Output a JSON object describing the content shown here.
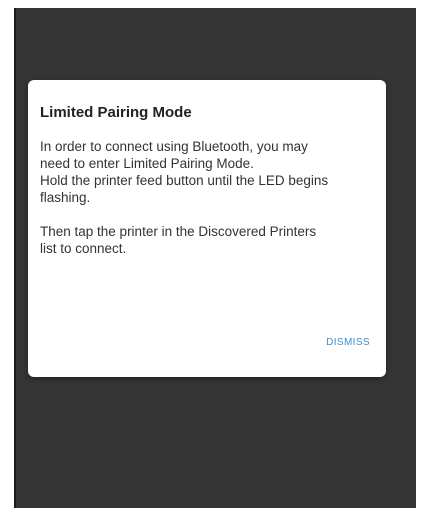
{
  "dialog": {
    "title": "Limited Pairing Mode",
    "body_lines": [
      "In order to connect using Bluetooth, you may",
      "need to enter Limited Pairing Mode.",
      "Hold the printer feed button until the LED begins",
      "flashing."
    ],
    "body_lines_2": [
      "Then tap the printer in the Discovered Printers",
      "list to connect."
    ],
    "dismiss_label": "DISMISS"
  },
  "colors": {
    "screen_background": "#353535",
    "dialog_background": "#ffffff",
    "accent": "#3a8fd0"
  }
}
